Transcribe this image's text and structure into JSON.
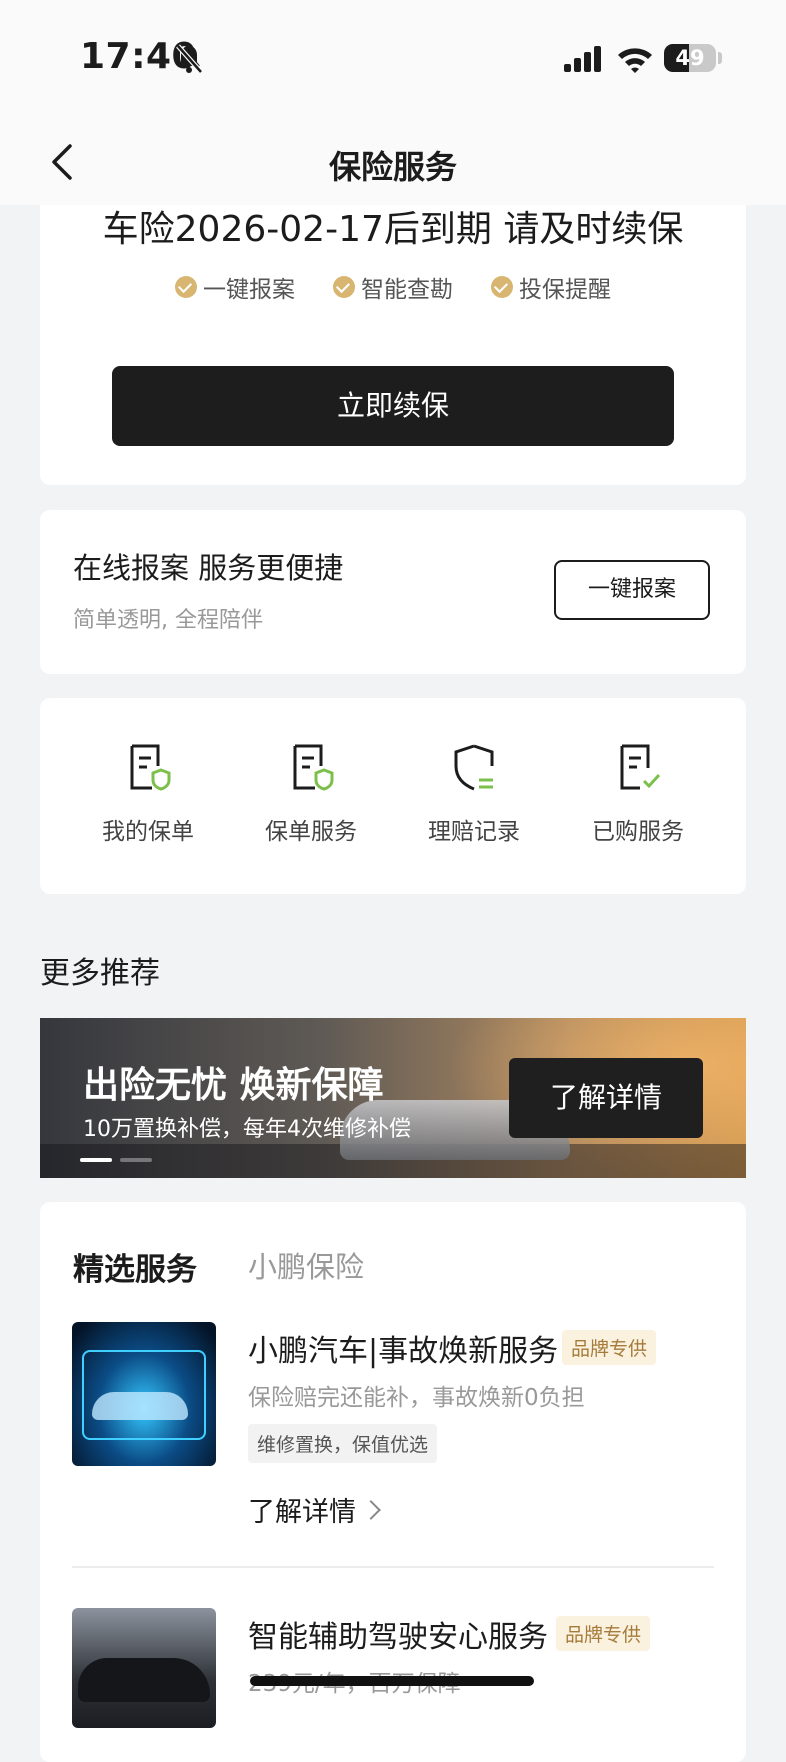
{
  "status_bar": {
    "time": "17:40",
    "battery": "49",
    "battery_level": 0.49
  },
  "header": {
    "title": "保险服务"
  },
  "insurance_card": {
    "expire_text": "车险2026-02-17后到期 请及时续保",
    "features": [
      "一键报案",
      "智能查勘",
      "投保提醒"
    ],
    "renew_button": "立即续保"
  },
  "report_card": {
    "title": "在线报案 服务更便捷",
    "subtitle": "简单透明, 全程陪伴",
    "button": "一键报案"
  },
  "services": [
    {
      "label": "我的保单",
      "icon": "policy-shield-icon"
    },
    {
      "label": "保单服务",
      "icon": "policy-service-icon"
    },
    {
      "label": "理赔记录",
      "icon": "claim-record-icon"
    },
    {
      "label": "已购服务",
      "icon": "purchased-check-icon"
    }
  ],
  "more": {
    "title": "更多推荐"
  },
  "banner": {
    "title": "出险无忧 焕新保障",
    "subtitle": "10万置换补偿，每年4次维修补偿",
    "button": "了解详情"
  },
  "featured": {
    "tabs": [
      "精选服务",
      "小鹏保险"
    ],
    "products": [
      {
        "title": "小鹏汽车|事故焕新服务",
        "tag": "品牌专供",
        "desc": "保险赔完还能补，事故焕新0负担",
        "chip": "维修置换，保值优选",
        "link": "了解详情"
      },
      {
        "title": "智能辅助驾驶安心服务",
        "tag": "品牌专供",
        "desc": "239元/年，百万保障"
      }
    ]
  },
  "colors": {
    "accent_gold": "#d8b671",
    "primary_dark": "#1d1d1d",
    "icon_green": "#7cc04b"
  }
}
